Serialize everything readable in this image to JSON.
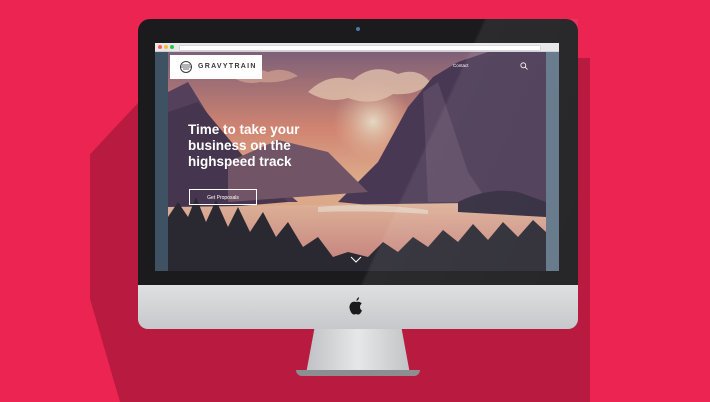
{
  "brand": {
    "name": "GRAVYTRAIN"
  },
  "nav": {
    "items": [
      "",
      "",
      "",
      "",
      ""
    ],
    "contact": "Contact"
  },
  "hero": {
    "headline_line1": "Time to take your",
    "headline_line2": "business on the",
    "headline_line3": "highspeed track",
    "cta_label": "Get Proposals"
  },
  "icons": {
    "search": "search-icon",
    "scroll": "chevron-down-icon",
    "logo": "train-logo-icon",
    "brand": "apple-logo-icon"
  },
  "colors": {
    "background": "#ec2451",
    "bezel": "#1b1b1d",
    "sky": "#f0a07a",
    "mountains": "#4b3a58"
  }
}
